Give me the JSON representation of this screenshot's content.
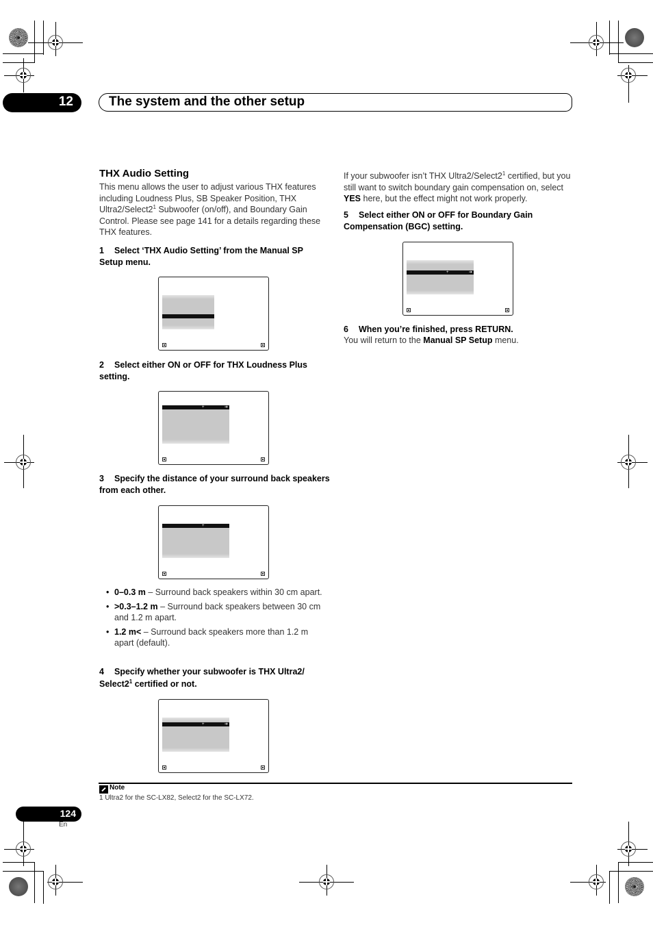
{
  "header": {
    "chapter_number": "12",
    "chapter_title": "The system and the other setup"
  },
  "left_column": {
    "section_title": "THX Audio Setting",
    "intro": {
      "part1": "This menu allows the user to adjust various THX features including Loudness Plus, SB Speaker Position, THX Ultra2/Select2",
      "sup": "1",
      "part2": " Subwoofer (on/off), and Boundary Gain Control. Please see page 141 for a details regarding these THX features."
    },
    "steps": [
      {
        "num": "1",
        "text": "Select ‘THX Audio Setting’ from the Manual SP Setup menu."
      },
      {
        "num": "2",
        "text": "Select either ON or OFF for THX Loudness Plus setting."
      },
      {
        "num": "3",
        "text": "Specify the distance of your surround back speakers from each other."
      },
      {
        "num": "4",
        "text_before": "Specify whether your subwoofer is THX Ultra2/ Select2",
        "sup": "1",
        "text_after": " certified or not."
      }
    ],
    "distance_options": [
      {
        "label": "0–0.3 m",
        "desc": " – Surround back speakers within 30 cm apart."
      },
      {
        "label": ">0.3–1.2 m",
        "desc": " – Surround back speakers between 30 cm and 1.2 m apart."
      },
      {
        "label": "1.2 m<",
        "desc": " – Surround back speakers more than 1.2 m apart (default)."
      }
    ]
  },
  "right_column": {
    "subwoofer_note": {
      "part1": "If your subwoofer isn’t THX Ultra2/Select2",
      "sup": "1",
      "part2": " certified, but you still want to switch boundary gain compensation on, select ",
      "bold": "YES",
      "part3": " here, but the effect might not work properly."
    },
    "steps": [
      {
        "num": "5",
        "text": "Select either ON or OFF for Boundary Gain Compensation (BGC) setting."
      },
      {
        "num": "6",
        "text": "When you’re finished, press RETURN."
      }
    ],
    "return_text": {
      "part1": "You will return to the ",
      "bold": "Manual SP Setup",
      "part2": " menu."
    }
  },
  "osd_icons": {
    "left": "home-icon",
    "right": "return-icon",
    "marker_plus": "+",
    "marker_arrow": "➔"
  },
  "footer": {
    "note_label": "Note",
    "note_text": "1 Ultra2 for the SC-LX82, Select2 for the SC-LX72.",
    "page_number": "124",
    "language": "En"
  }
}
